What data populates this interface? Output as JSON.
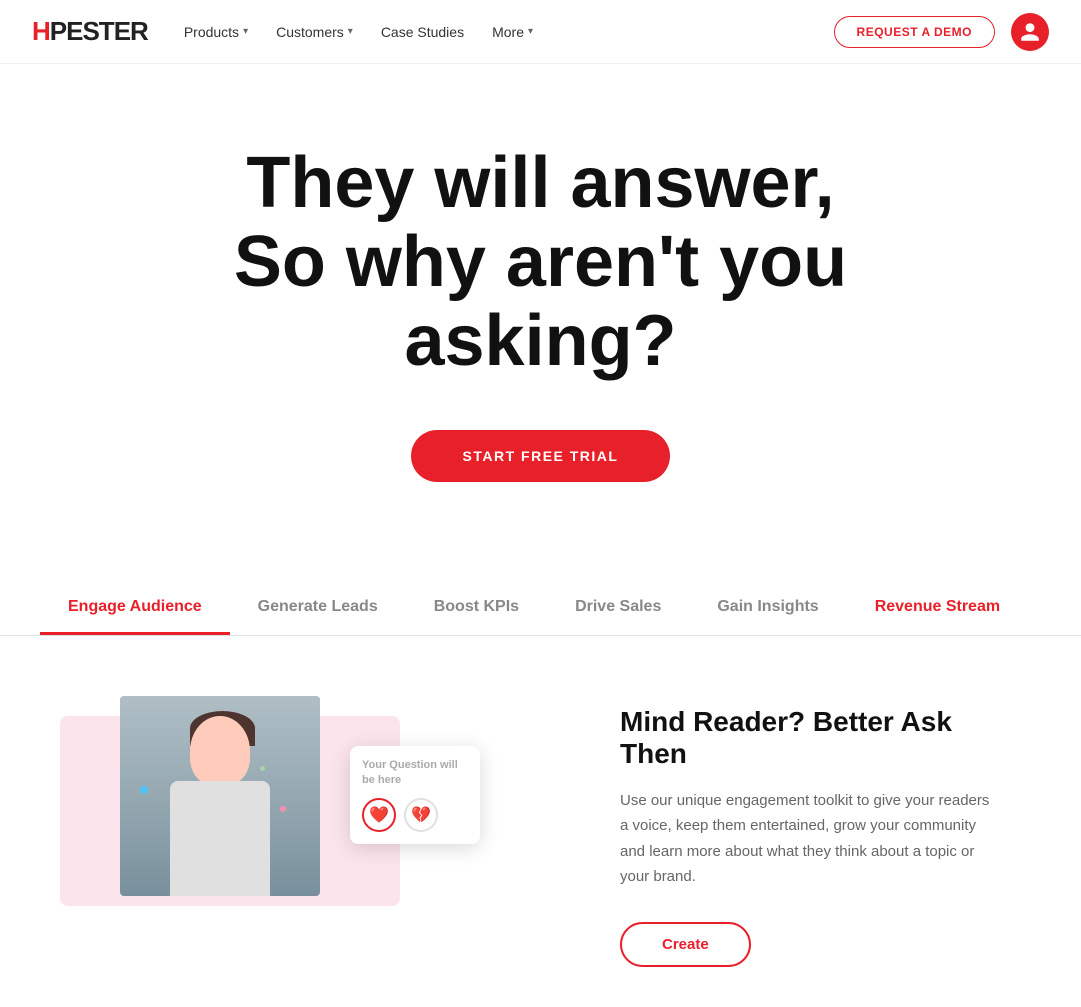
{
  "brand": {
    "logo_prefix": "H",
    "logo_name": "PESTER",
    "logo_full": "HPESTER"
  },
  "nav": {
    "links": [
      {
        "label": "Products",
        "has_arrow": true
      },
      {
        "label": "Customers",
        "has_arrow": true
      },
      {
        "label": "Case Studies",
        "has_arrow": false
      },
      {
        "label": "More",
        "has_arrow": true
      }
    ],
    "demo_button": "REQUEST A DEMO",
    "avatar_icon": "person"
  },
  "hero": {
    "headline_line1": "They will answer,",
    "headline_line2": "So why aren't you asking?",
    "cta_button": "START FREE TRIAL"
  },
  "tabs": [
    {
      "label": "Engage Audience",
      "active": true
    },
    {
      "label": "Generate Leads",
      "active": false
    },
    {
      "label": "Boost KPIs",
      "active": false
    },
    {
      "label": "Drive Sales",
      "active": false
    },
    {
      "label": "Gain Insights",
      "active": false
    },
    {
      "label": "Revenue Stream",
      "active": false,
      "red": true
    }
  ],
  "section": {
    "heading": "Mind Reader? Better Ask Then",
    "body": "Use our unique engagement toolkit to give your readers a voice, keep them entertained, grow your community and learn more about what they think about a topic or your brand.",
    "create_button": "Create"
  },
  "question_card": {
    "label": "Your Question will be here",
    "reaction1": "❤️",
    "reaction2": "💔"
  },
  "colors": {
    "red": "#e8202a",
    "pink_bg": "#fce4ec"
  }
}
